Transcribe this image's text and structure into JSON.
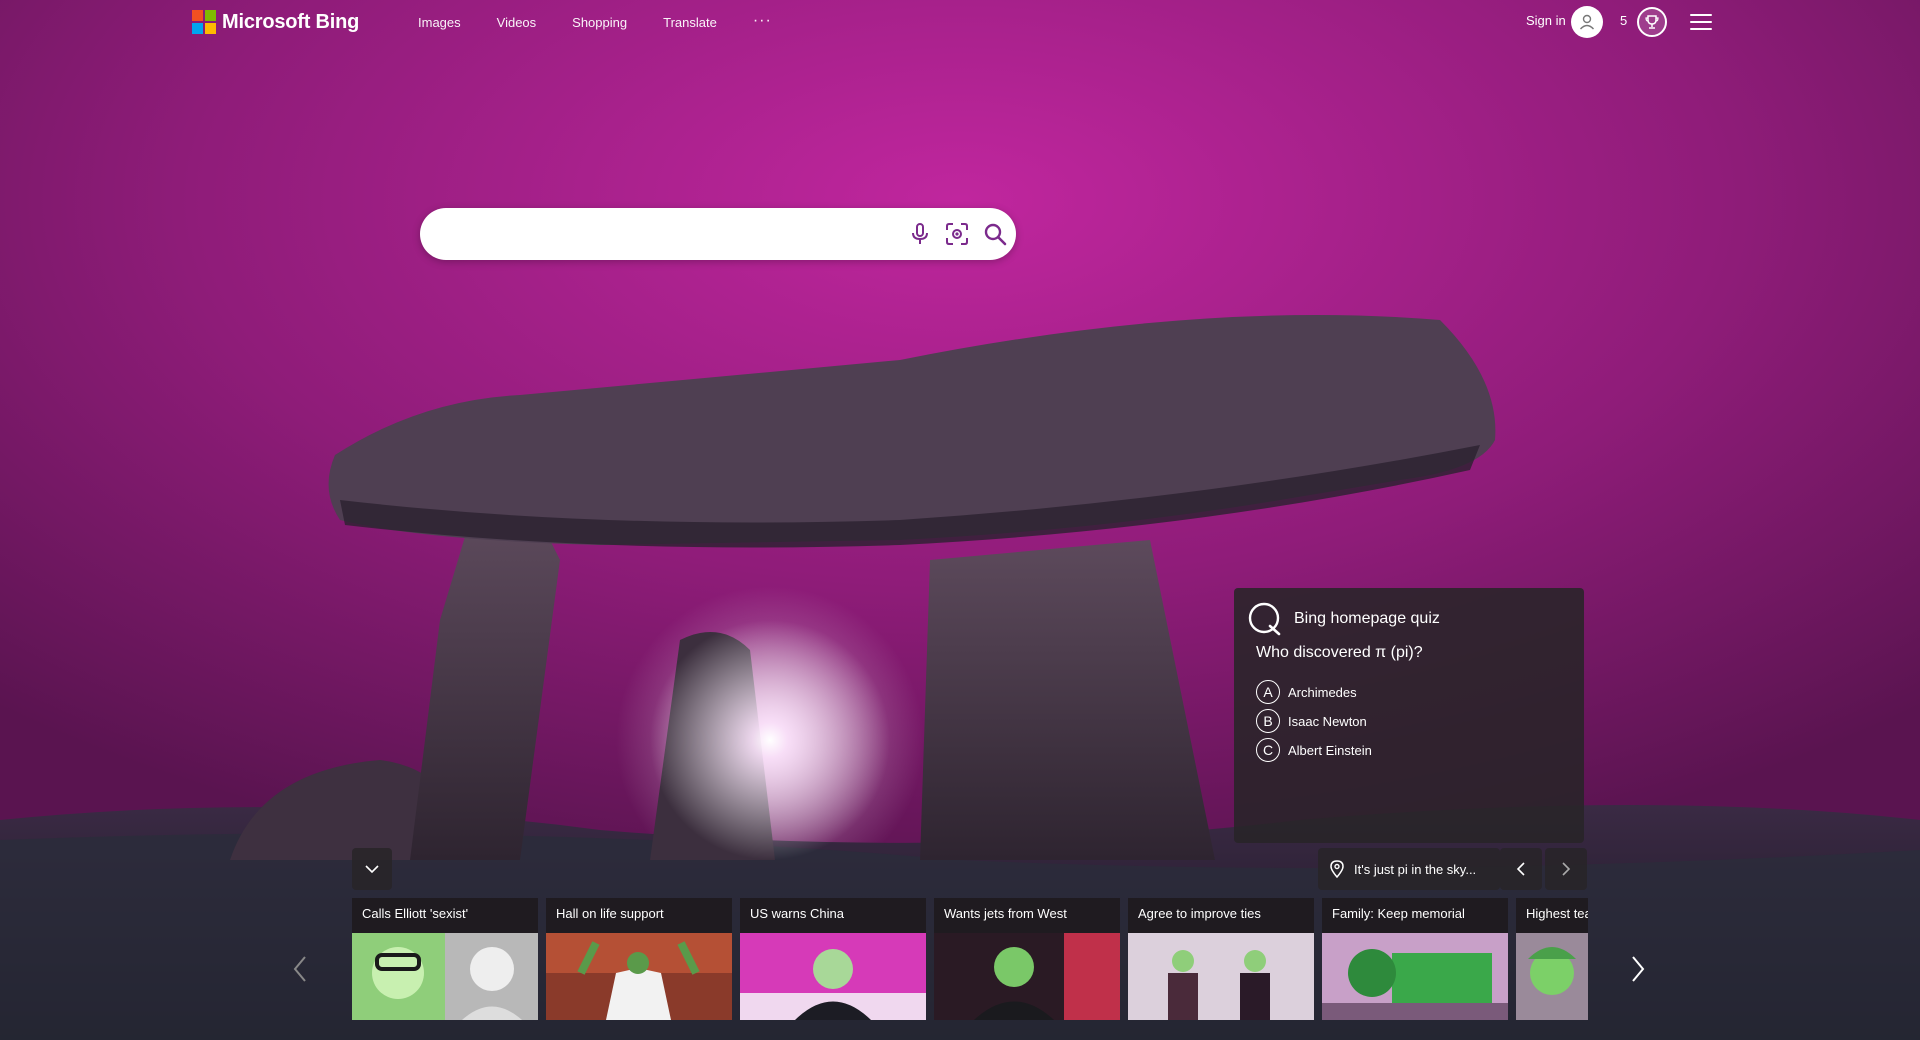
{
  "header": {
    "logo_text": "Microsoft Bing",
    "nav": [
      "Images",
      "Videos",
      "Shopping",
      "Translate"
    ],
    "more_label": "···",
    "signin_label": "Sign in",
    "rewards_points": "5"
  },
  "search": {
    "placeholder": ""
  },
  "quiz": {
    "title": "Bing homepage quiz",
    "question": "Who discovered π (pi)?",
    "options": [
      {
        "letter": "A",
        "text": "Archimedes"
      },
      {
        "letter": "B",
        "text": "Isaac Newton"
      },
      {
        "letter": "C",
        "text": "Albert Einstein"
      }
    ]
  },
  "image_info": {
    "caption": "It's just pi in the sky..."
  },
  "news": [
    {
      "caption": "Calls Elliott 'sexist'"
    },
    {
      "caption": "Hall on life support"
    },
    {
      "caption": "US warns China"
    },
    {
      "caption": "Wants jets from West"
    },
    {
      "caption": "Agree to improve ties"
    },
    {
      "caption": "Family: Keep memorial"
    },
    {
      "caption": "Highest tea"
    }
  ],
  "colors": {
    "sky": "#b8249a",
    "card_bg": "#282428",
    "search_icon": "#7b2a8c"
  }
}
